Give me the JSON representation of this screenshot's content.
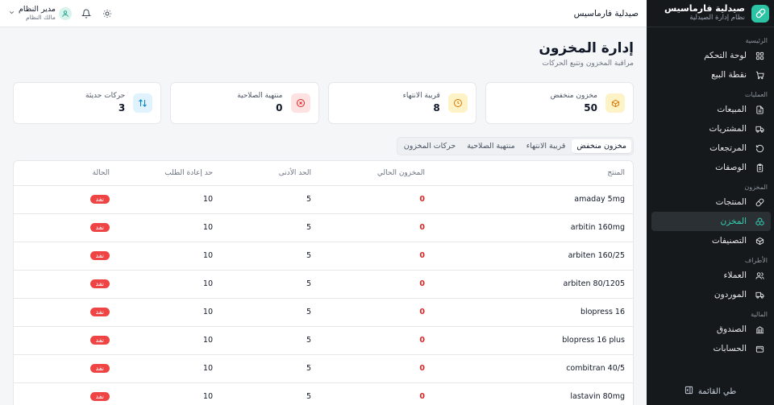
{
  "brand": {
    "title": "صيدلية فارماسيس",
    "subtitle": "نظام إدارة الصيدلية"
  },
  "header": {
    "title": "صيدلية فارماسيس",
    "user": {
      "name": "مدير النظام",
      "role": "مالك النظام"
    }
  },
  "sidebar": {
    "groups": [
      {
        "title": "الرئيسية",
        "items": [
          {
            "label": "لوحة التحكم",
            "icon": "grid-icon"
          },
          {
            "label": "نقطة البيع",
            "icon": "cart-icon"
          }
        ]
      },
      {
        "title": "العمليات",
        "items": [
          {
            "label": "المبيعات",
            "icon": "receipt-icon"
          },
          {
            "label": "المشتريات",
            "icon": "truck-icon"
          },
          {
            "label": "المرتجعات",
            "icon": "return-icon"
          },
          {
            "label": "الوصفات",
            "icon": "clipboard-icon"
          }
        ]
      },
      {
        "title": "المخزون",
        "items": [
          {
            "label": "المنتجات",
            "icon": "pill-icon"
          },
          {
            "label": "المخزن",
            "icon": "boxes-icon"
          },
          {
            "label": "التصنيفات",
            "icon": "package-icon"
          }
        ]
      },
      {
        "title": "الأطراف",
        "items": [
          {
            "label": "العملاء",
            "icon": "users-icon"
          },
          {
            "label": "الموردون",
            "icon": "truck-icon"
          }
        ]
      },
      {
        "title": "المالية",
        "items": [
          {
            "label": "الصندوق",
            "icon": "bank-icon"
          },
          {
            "label": "الحسابات",
            "icon": "wallet-icon"
          }
        ]
      }
    ],
    "collapse_label": "طي القائمة"
  },
  "page": {
    "title": "إدارة المخزون",
    "subtitle": "مراقبة المخزون وتتبع الحركات"
  },
  "stats": [
    {
      "label": "مخزون منخفض",
      "value": "50",
      "icon": "package-icon",
      "color": "#d97706",
      "bg": "#fef3c7"
    },
    {
      "label": "قريبة الانتهاء",
      "value": "8",
      "icon": "clock-icon",
      "color": "#d97706",
      "bg": "#fef3c7"
    },
    {
      "label": "منتهية الصلاحية",
      "value": "0",
      "icon": "x-circle-icon",
      "color": "#dc2626",
      "bg": "#fee2e2"
    },
    {
      "label": "حركات حديثة",
      "value": "3",
      "icon": "arrows-icon",
      "color": "#0284c7",
      "bg": "#e0f2fe"
    }
  ],
  "tabs": [
    "مخزون منخفض",
    "قريبة الانتهاء",
    "منتهية الصلاحية",
    "حركات المخزون"
  ],
  "table": {
    "headers": {
      "product": "المنتج",
      "current": "المخزون الحالي",
      "min": "الحد الأدنى",
      "reorder": "حد إعادة الطلب",
      "status": "الحالة"
    },
    "rows": [
      {
        "product": "amaday 5mg",
        "current": "0",
        "min": "5",
        "reorder": "10",
        "status": "نفد"
      },
      {
        "product": "arbitin 160mg",
        "current": "0",
        "min": "5",
        "reorder": "10",
        "status": "نفد"
      },
      {
        "product": "arbiten 160/25",
        "current": "0",
        "min": "5",
        "reorder": "10",
        "status": "نفد"
      },
      {
        "product": "arbiten 80/1205",
        "current": "0",
        "min": "5",
        "reorder": "10",
        "status": "نفد"
      },
      {
        "product": "blopress 16",
        "current": "0",
        "min": "5",
        "reorder": "10",
        "status": "نفد"
      },
      {
        "product": "blopress 16 plus",
        "current": "0",
        "min": "5",
        "reorder": "10",
        "status": "نفد"
      },
      {
        "product": "combitran 40/5",
        "current": "0",
        "min": "5",
        "reorder": "10",
        "status": "نفد"
      },
      {
        "product": "lastavin 80mg",
        "current": "0",
        "min": "5",
        "reorder": "10",
        "status": "نفد"
      }
    ]
  },
  "colors": {
    "accent": "#2cc4a4",
    "sidebar_bg": "#16191c",
    "danger": "#ef4444"
  }
}
